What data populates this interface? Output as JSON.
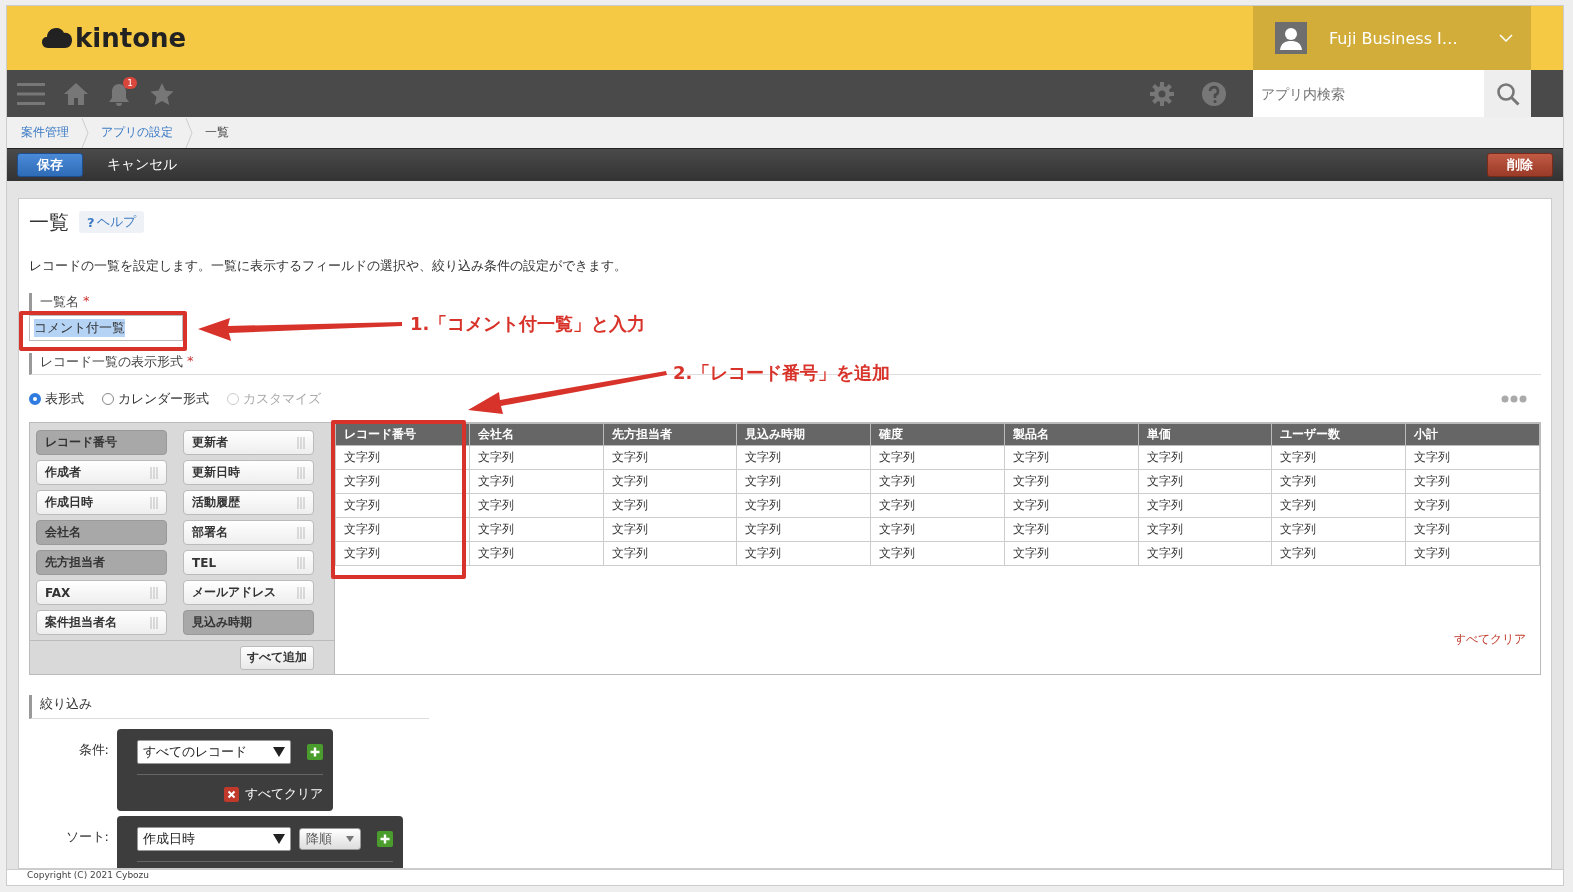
{
  "header": {
    "logo": "kintone",
    "user_name": "Fuji Business I…"
  },
  "toolbar": {
    "notification_count": "1",
    "search": {
      "placeholder": "アプリ内検索"
    }
  },
  "breadcrumb": [
    "案件管理",
    "アプリの設定",
    "一覧"
  ],
  "actions": {
    "save": "保存",
    "cancel": "キャンセル",
    "delete": "削除"
  },
  "page": {
    "title": "一覧",
    "help_mark": "?",
    "help": "ヘルプ",
    "description": "レコードの一覧を設定します。一覧に表示するフィールドの選択や、絞り込み条件の設定ができます。"
  },
  "view_name": {
    "label": "一覧名",
    "required_mark": "*",
    "value": "コメント付一覧",
    "text_selected": true
  },
  "display_format": {
    "label": "レコード一覧の表示形式",
    "required_mark": "*",
    "options": [
      {
        "label": "表形式",
        "selected": true,
        "disabled": false
      },
      {
        "label": "カレンダー形式",
        "selected": false,
        "disabled": false
      },
      {
        "label": "カスタマイズ",
        "selected": false,
        "disabled": true
      }
    ]
  },
  "field_palette": {
    "columns": [
      [
        {
          "label": "レコード番号",
          "used": true
        },
        {
          "label": "作成者",
          "used": false
        },
        {
          "label": "作成日時",
          "used": false
        },
        {
          "label": "会社名",
          "used": true
        },
        {
          "label": "先方担当者",
          "used": true
        },
        {
          "label": "FAX",
          "used": false
        },
        {
          "label": "案件担当者名",
          "used": false
        }
      ],
      [
        {
          "label": "更新者",
          "used": false
        },
        {
          "label": "更新日時",
          "used": false
        },
        {
          "label": "活動履歴",
          "used": false
        },
        {
          "label": "部署名",
          "used": false
        },
        {
          "label": "TEL",
          "used": false
        },
        {
          "label": "メールアドレス",
          "used": false
        },
        {
          "label": "見込み時期",
          "used": true
        }
      ]
    ],
    "add_all": "すべて追加"
  },
  "table": {
    "columns": [
      "レコード番号",
      "会社名",
      "先方担当者",
      "見込み時期",
      "確度",
      "製品名",
      "単価",
      "ユーザー数",
      "小計"
    ],
    "rows": [
      [
        "文字列",
        "文字列",
        "文字列",
        "文字列",
        "文字列",
        "文字列",
        "文字列",
        "文字列",
        "文字列"
      ],
      [
        "文字列",
        "文字列",
        "文字列",
        "文字列",
        "文字列",
        "文字列",
        "文字列",
        "文字列",
        "文字列"
      ],
      [
        "文字列",
        "文字列",
        "文字列",
        "文字列",
        "文字列",
        "文字列",
        "文字列",
        "文字列",
        "文字列"
      ],
      [
        "文字列",
        "文字列",
        "文字列",
        "文字列",
        "文字列",
        "文字列",
        "文字列",
        "文字列",
        "文字列"
      ],
      [
        "文字列",
        "文字列",
        "文字列",
        "文字列",
        "文字列",
        "文字列",
        "文字列",
        "文字列",
        "文字列"
      ]
    ],
    "clear_all": "すべてクリア"
  },
  "filter": {
    "title": "絞り込み",
    "condition_label": "条件:",
    "condition": "すべてのレコード",
    "condition_clear": "すべてクリア",
    "sort_label": "ソート:",
    "sort_field": "作成日時",
    "sort_order": "降順"
  },
  "annotations": [
    {
      "text": "1.「コメント付一覧」と入力"
    },
    {
      "text": "2.「レコード番号」を追加"
    }
  ],
  "footer": "Copyright (C) 2021 Cybozu"
}
